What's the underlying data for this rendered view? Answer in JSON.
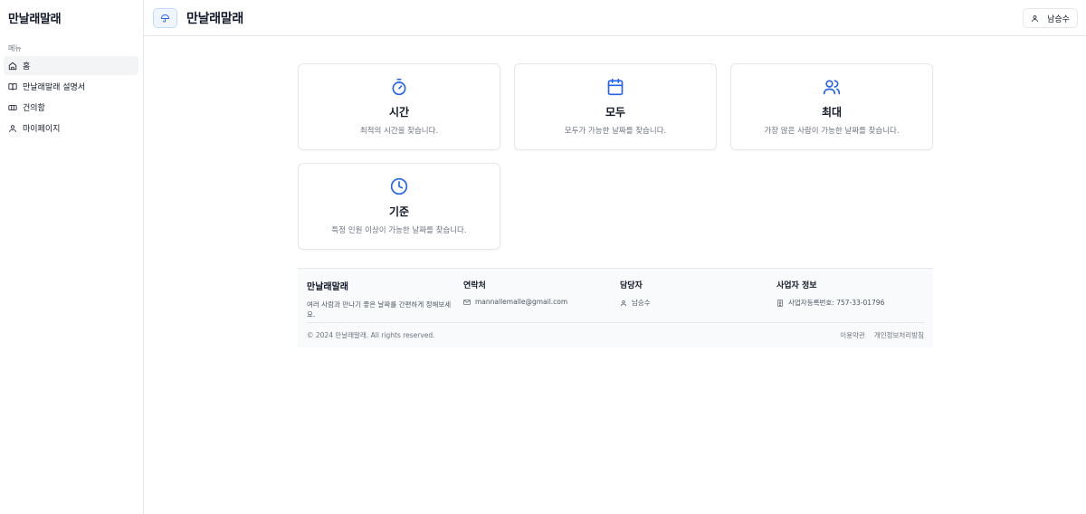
{
  "sidebar": {
    "brand": "만날래말래",
    "menu_label": "메뉴",
    "items": [
      {
        "label": "홈",
        "icon": "home-icon"
      },
      {
        "label": "만날래말래 설명서",
        "icon": "book-open-icon"
      },
      {
        "label": "건의함",
        "icon": "ticket-icon"
      },
      {
        "label": "마이페이지",
        "icon": "user-icon"
      }
    ]
  },
  "header": {
    "title": "만날래말래",
    "user_name": "남승수"
  },
  "cards": [
    {
      "title": "시간",
      "desc": "최적의 시간을 찾습니다.",
      "icon": "timer-icon"
    },
    {
      "title": "모두",
      "desc": "모두가 가능한 날짜를 찾습니다.",
      "icon": "calendar-icon"
    },
    {
      "title": "최대",
      "desc": "가장 많은 사람이 가능한 날짜를 찾습니다.",
      "icon": "users-icon"
    },
    {
      "title": "기준",
      "desc": "특정 인원 이상이 가능한 날짜를 찾습니다.",
      "icon": "clock-icon"
    }
  ],
  "footer": {
    "brand": "만날래말래",
    "tagline": "여러 사람과 만나기 좋은 날짜를 간편하게 정해보세요.",
    "contact_heading": "연락처",
    "contact_email": "mannallemalle@gmail.com",
    "manager_heading": "담당자",
    "manager_name": "남승수",
    "business_heading": "사업자 정보",
    "business_number": "사업자등록번호: 757-33-01796",
    "copyright": "© 2024 만날래말래. All rights reserved.",
    "terms_link": "이용약관",
    "privacy_link": "개인정보처리방침"
  },
  "colors": {
    "accent": "#2563eb",
    "border": "#e5e7eb",
    "active_bg": "#f3f4f6",
    "muted_text": "#6b7280"
  }
}
